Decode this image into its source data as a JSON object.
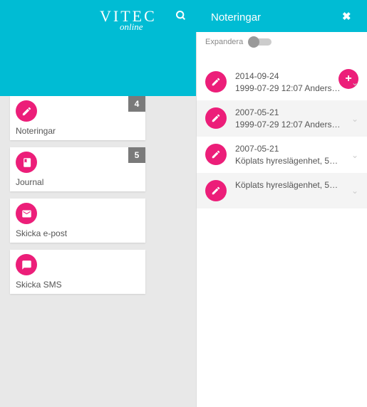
{
  "logo": {
    "text": "VITEC",
    "sub": "online"
  },
  "header": {
    "panel_title": "Noteringar"
  },
  "expand_label": "Expandera",
  "tiles": [
    {
      "label": "Noteringar",
      "badge": "4"
    },
    {
      "label": "Journal",
      "badge": "5"
    },
    {
      "label": "Skicka e-post",
      "badge": ""
    },
    {
      "label": "Skicka SMS",
      "badge": ""
    }
  ],
  "entries": [
    {
      "date": "2014-09-24",
      "detail": "1999-07-29 12:07 Anders…"
    },
    {
      "date": "2007-05-21",
      "detail": "1999-07-29 12:07 Anders…"
    },
    {
      "date": "2007-05-21",
      "detail": "Köplats hyreslägenhet, 5…"
    },
    {
      "date": "",
      "detail": "Köplats hyreslägenhet, 5…"
    }
  ]
}
